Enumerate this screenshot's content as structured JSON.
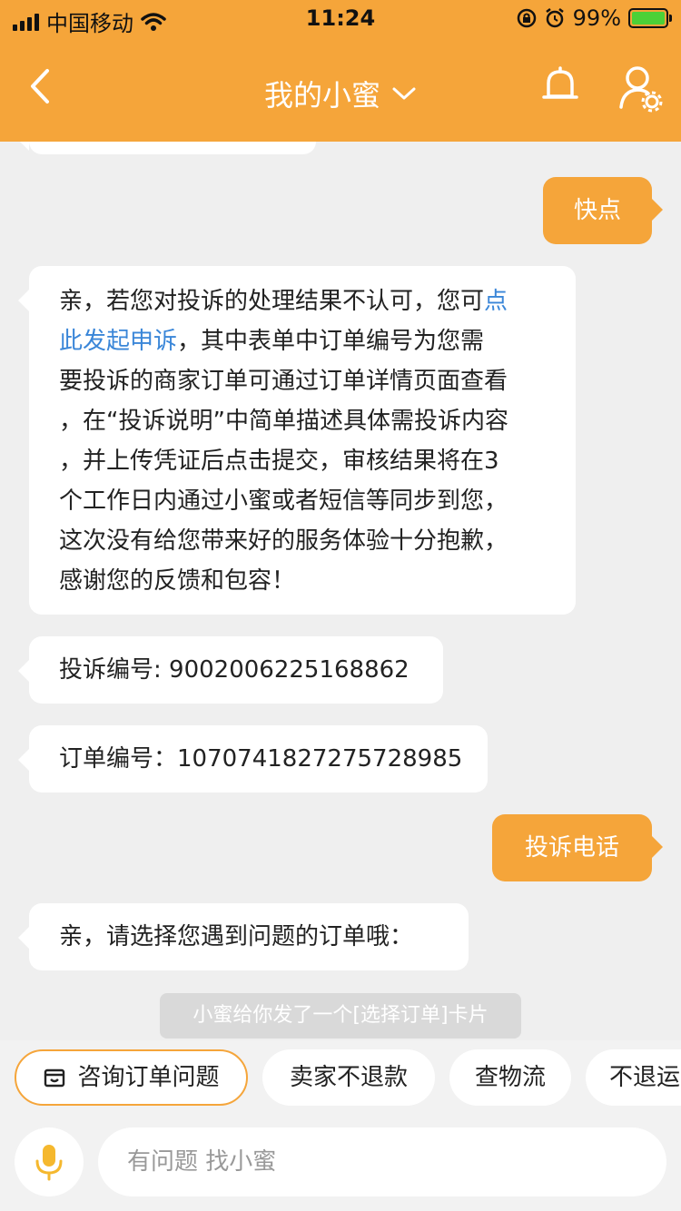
{
  "status_bar": {
    "carrier": "中国移动",
    "time": "11:24",
    "battery_percent": "99%"
  },
  "header": {
    "title": "我的小蜜"
  },
  "messages": [
    {
      "side": "right",
      "text": "快点"
    },
    {
      "side": "left",
      "link_text_1": "点",
      "link_text_2": "此发起申诉",
      "line1_prefix": "亲，若您对投诉的处理结果不认可，您可",
      "line2_suffix": "，其中表单中订单编号为您需",
      "line3": "要投诉的商家订单可通过订单详情页面查看",
      "line4": "，在“投诉说明”中简单描述具体需投诉内容",
      "line5": "，并上传凭证后点击提交，审核结果将在3",
      "line6": "个工作日内通过小蜜或者短信等同步到您，",
      "line7": "这次没有给您带来好的服务体验十分抱歉，",
      "line8": "感谢您的反馈和包容！"
    },
    {
      "side": "left",
      "text": "投诉编号: 9002006225168862"
    },
    {
      "side": "left",
      "text": "订单编号：1070741827275728985"
    },
    {
      "side": "right",
      "text": "投诉电话"
    },
    {
      "side": "left",
      "text": "亲，请选择您遇到问题的订单哦："
    }
  ],
  "system_note": "小蜜给你发了一个[选择订单]卡片",
  "quick_actions": [
    "咨询订单问题",
    "卖家不退款",
    "查物流",
    "不退运"
  ],
  "input": {
    "placeholder": "有问题 找小蜜"
  },
  "colors": {
    "accent": "#f5a53a",
    "link": "#3a86d8",
    "background": "#efefef"
  }
}
